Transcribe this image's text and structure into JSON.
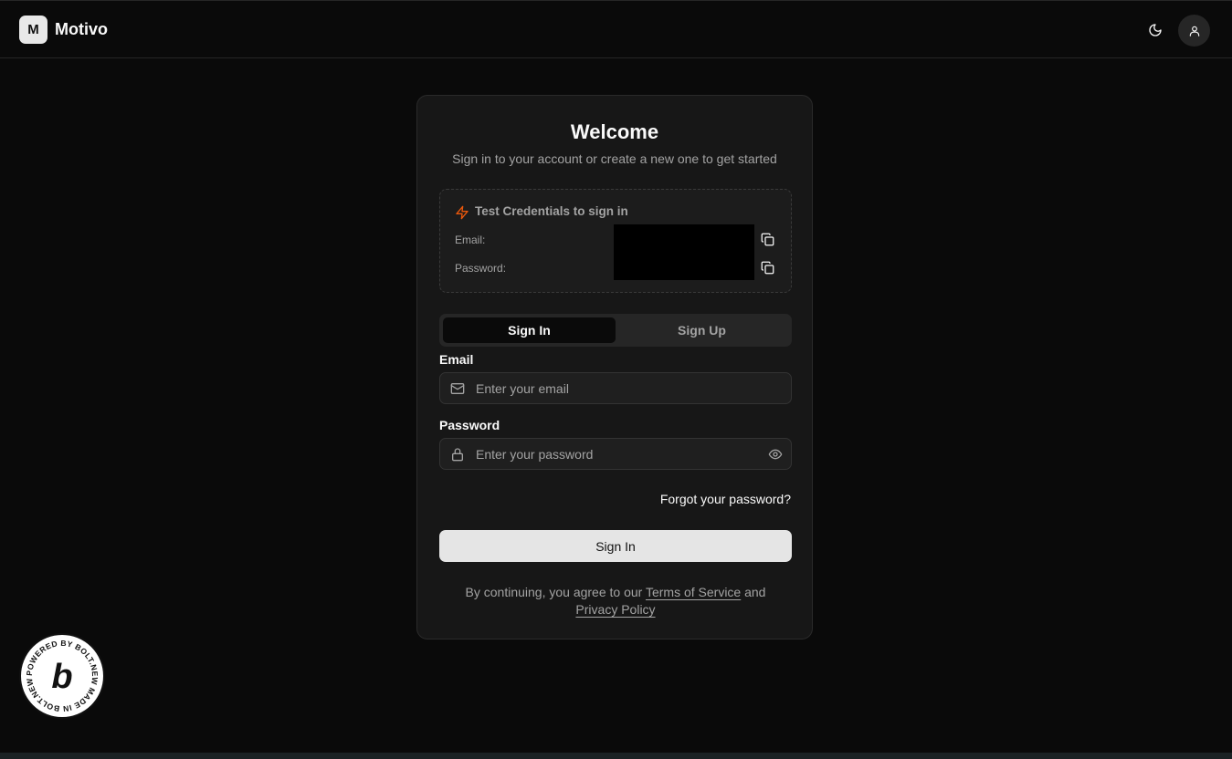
{
  "header": {
    "logo_letter": "M",
    "brand": "Motivo"
  },
  "card": {
    "title": "Welcome",
    "subtitle": "Sign in to your account or create a new one to get started",
    "credentials": {
      "title": "Test Credentials to sign in",
      "email_label": "Email:",
      "password_label": "Password:"
    },
    "tabs": [
      {
        "label": "Sign In",
        "active": true
      },
      {
        "label": "Sign Up",
        "active": false
      }
    ],
    "email": {
      "label": "Email",
      "placeholder": "Enter your email",
      "value": ""
    },
    "password": {
      "label": "Password",
      "placeholder": "Enter your password",
      "value": ""
    },
    "forgot": "Forgot your password?",
    "submit": "Sign In",
    "terms": {
      "prefix": "By continuing, you agree to our",
      "tos": "Terms of Service",
      "and": "and",
      "privacy": "Privacy Policy"
    }
  },
  "badge": {
    "text": "POWERED BY BOLT.NEW MADE IN BOLT.NEW"
  },
  "colors": {
    "background": "#0a0a0a",
    "card": "#171717",
    "accent_bolt": "#ea580c",
    "button": "#e5e5e5"
  }
}
